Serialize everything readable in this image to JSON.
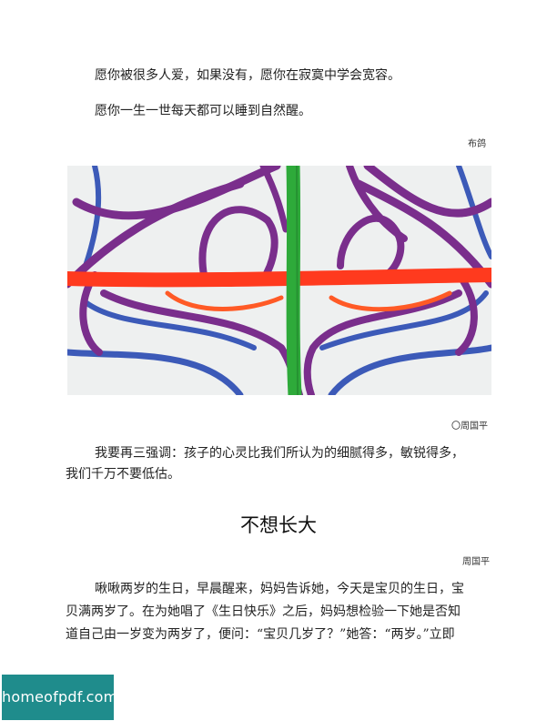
{
  "top_quote": {
    "line1": "愿你被很多人爱，如果没有，愿你在寂寞中学会宽容。",
    "line2": "愿你一生一世每天都可以睡到自然醒。",
    "signature": "布鸽"
  },
  "artwork": {
    "credit": "〇周国平",
    "colors": {
      "background": "#eef0f0",
      "purple": "#7a2e8c",
      "blue": "#3c5ab8",
      "red": "#ff3a1e",
      "green": "#2eaa3a"
    }
  },
  "essay_intro": {
    "line1": "我要再三强调：孩子的心灵比我们所认为的细腻得多，敏锐得多，",
    "line2": "我们千万不要低估。"
  },
  "section": {
    "title": "不想长大",
    "author": "周国平",
    "body_line1": "啾啾两岁的生日，早晨醒来，妈妈告诉她，今天是宝贝的生日，宝",
    "body_line2": "贝满两岁了。在为她唱了《生日快乐》之后，妈妈想检验一下她是否知",
    "body_line3": "道自己由一岁变为两岁了，便问：“宝贝几岁了？”她答：“两岁。”立即"
  },
  "watermark": {
    "text": "homeofpdf.com"
  }
}
